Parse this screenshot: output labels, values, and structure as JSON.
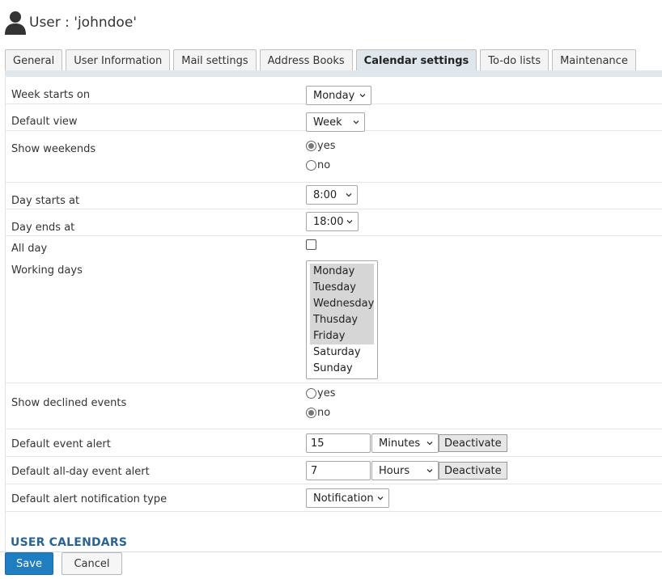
{
  "header": {
    "icon": "user-icon",
    "title": "User : 'johndoe'"
  },
  "tabs": [
    {
      "label": "General",
      "active": false
    },
    {
      "label": "User Information",
      "active": false
    },
    {
      "label": "Mail settings",
      "active": false
    },
    {
      "label": "Address Books",
      "active": false
    },
    {
      "label": "Calendar settings",
      "active": true
    },
    {
      "label": "To-do lists",
      "active": false
    },
    {
      "label": "Maintenance",
      "active": false
    }
  ],
  "settings": {
    "week_starts_on": {
      "label": "Week starts on",
      "value": "Monday"
    },
    "default_view": {
      "label": "Default view",
      "value": "Week"
    },
    "show_weekends": {
      "label": "Show weekends",
      "options": [
        "yes",
        "no"
      ],
      "selected": "yes"
    },
    "day_starts_at": {
      "label": "Day starts at",
      "value": "8:00"
    },
    "day_ends_at": {
      "label": "Day ends at",
      "value": "18:00"
    },
    "all_day": {
      "label": "All day",
      "checked": false
    },
    "working_days": {
      "label": "Working days",
      "options": [
        "Monday",
        "Tuesday",
        "Wednesday",
        "Thusday",
        "Friday",
        "Saturday",
        "Sunday"
      ],
      "selected": [
        "Monday",
        "Tuesday",
        "Wednesday",
        "Thusday",
        "Friday"
      ]
    },
    "show_declined_events": {
      "label": "Show declined events",
      "options": [
        "yes",
        "no"
      ],
      "selected": "no"
    },
    "default_event_alert": {
      "label": "Default event alert",
      "value": "15",
      "unit": "Minutes",
      "button": "Deactivate"
    },
    "default_allday_alert": {
      "label": "Default all-day event alert",
      "value": "7",
      "unit": "Hours",
      "button": "Deactivate"
    },
    "default_alert_type": {
      "label": "Default alert notification type",
      "value": "Notification"
    }
  },
  "section_title": "USER CALENDARS",
  "footer": {
    "save_label": "Save",
    "cancel_label": "Cancel"
  },
  "colors": {
    "accent": "#1f7ec2",
    "section_title": "#2a6496",
    "tab_active": "#dfe7ec"
  }
}
